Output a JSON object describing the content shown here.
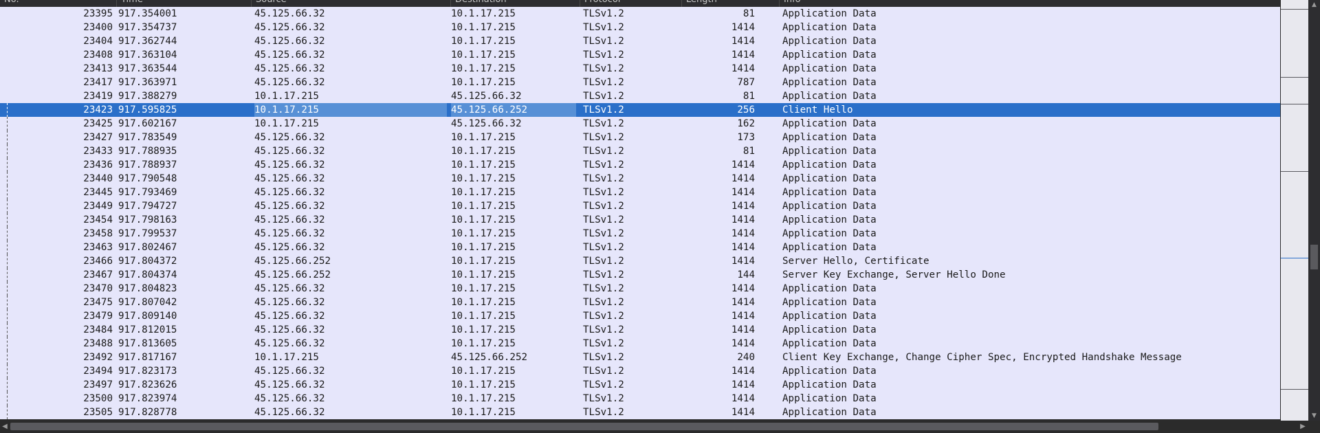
{
  "columns": {
    "no": "No.",
    "time": "Time",
    "source": "Source",
    "destination": "Destination",
    "protocol": "Protocol",
    "length": "Length",
    "info": "Info"
  },
  "colors": {
    "row_bg": "#e6e6fb",
    "selected_bg": "#2a6fc9",
    "header_bg": "#2d2d30"
  },
  "selected_packet": "23423",
  "packets": [
    {
      "no": "23395",
      "time": "917.354001",
      "source": "45.125.66.32",
      "destination": "10.1.17.215",
      "protocol": "TLSv1.2",
      "length": "81",
      "info": "Application Data"
    },
    {
      "no": "23400",
      "time": "917.354737",
      "source": "45.125.66.32",
      "destination": "10.1.17.215",
      "protocol": "TLSv1.2",
      "length": "1414",
      "info": "Application Data"
    },
    {
      "no": "23404",
      "time": "917.362744",
      "source": "45.125.66.32",
      "destination": "10.1.17.215",
      "protocol": "TLSv1.2",
      "length": "1414",
      "info": "Application Data"
    },
    {
      "no": "23408",
      "time": "917.363104",
      "source": "45.125.66.32",
      "destination": "10.1.17.215",
      "protocol": "TLSv1.2",
      "length": "1414",
      "info": "Application Data"
    },
    {
      "no": "23413",
      "time": "917.363544",
      "source": "45.125.66.32",
      "destination": "10.1.17.215",
      "protocol": "TLSv1.2",
      "length": "1414",
      "info": "Application Data"
    },
    {
      "no": "23417",
      "time": "917.363971",
      "source": "45.125.66.32",
      "destination": "10.1.17.215",
      "protocol": "TLSv1.2",
      "length": "787",
      "info": "Application Data"
    },
    {
      "no": "23419",
      "time": "917.388279",
      "source": "10.1.17.215",
      "destination": "45.125.66.32",
      "protocol": "TLSv1.2",
      "length": "81",
      "info": "Application Data"
    },
    {
      "no": "23423",
      "time": "917.595825",
      "source": "10.1.17.215",
      "destination": "45.125.66.252",
      "protocol": "TLSv1.2",
      "length": "256",
      "info": "Client Hello"
    },
    {
      "no": "23425",
      "time": "917.602167",
      "source": "10.1.17.215",
      "destination": "45.125.66.32",
      "protocol": "TLSv1.2",
      "length": "162",
      "info": "Application Data"
    },
    {
      "no": "23427",
      "time": "917.783549",
      "source": "45.125.66.32",
      "destination": "10.1.17.215",
      "protocol": "TLSv1.2",
      "length": "173",
      "info": "Application Data"
    },
    {
      "no": "23433",
      "time": "917.788935",
      "source": "45.125.66.32",
      "destination": "10.1.17.215",
      "protocol": "TLSv1.2",
      "length": "81",
      "info": "Application Data"
    },
    {
      "no": "23436",
      "time": "917.788937",
      "source": "45.125.66.32",
      "destination": "10.1.17.215",
      "protocol": "TLSv1.2",
      "length": "1414",
      "info": "Application Data"
    },
    {
      "no": "23440",
      "time": "917.790548",
      "source": "45.125.66.32",
      "destination": "10.1.17.215",
      "protocol": "TLSv1.2",
      "length": "1414",
      "info": "Application Data"
    },
    {
      "no": "23445",
      "time": "917.793469",
      "source": "45.125.66.32",
      "destination": "10.1.17.215",
      "protocol": "TLSv1.2",
      "length": "1414",
      "info": "Application Data"
    },
    {
      "no": "23449",
      "time": "917.794727",
      "source": "45.125.66.32",
      "destination": "10.1.17.215",
      "protocol": "TLSv1.2",
      "length": "1414",
      "info": "Application Data"
    },
    {
      "no": "23454",
      "time": "917.798163",
      "source": "45.125.66.32",
      "destination": "10.1.17.215",
      "protocol": "TLSv1.2",
      "length": "1414",
      "info": "Application Data"
    },
    {
      "no": "23458",
      "time": "917.799537",
      "source": "45.125.66.32",
      "destination": "10.1.17.215",
      "protocol": "TLSv1.2",
      "length": "1414",
      "info": "Application Data"
    },
    {
      "no": "23463",
      "time": "917.802467",
      "source": "45.125.66.32",
      "destination": "10.1.17.215",
      "protocol": "TLSv1.2",
      "length": "1414",
      "info": "Application Data"
    },
    {
      "no": "23466",
      "time": "917.804372",
      "source": "45.125.66.252",
      "destination": "10.1.17.215",
      "protocol": "TLSv1.2",
      "length": "1414",
      "info": "Server Hello, Certificate"
    },
    {
      "no": "23467",
      "time": "917.804374",
      "source": "45.125.66.252",
      "destination": "10.1.17.215",
      "protocol": "TLSv1.2",
      "length": "144",
      "info": "Server Key Exchange, Server Hello Done"
    },
    {
      "no": "23470",
      "time": "917.804823",
      "source": "45.125.66.32",
      "destination": "10.1.17.215",
      "protocol": "TLSv1.2",
      "length": "1414",
      "info": "Application Data"
    },
    {
      "no": "23475",
      "time": "917.807042",
      "source": "45.125.66.32",
      "destination": "10.1.17.215",
      "protocol": "TLSv1.2",
      "length": "1414",
      "info": "Application Data"
    },
    {
      "no": "23479",
      "time": "917.809140",
      "source": "45.125.66.32",
      "destination": "10.1.17.215",
      "protocol": "TLSv1.2",
      "length": "1414",
      "info": "Application Data"
    },
    {
      "no": "23484",
      "time": "917.812015",
      "source": "45.125.66.32",
      "destination": "10.1.17.215",
      "protocol": "TLSv1.2",
      "length": "1414",
      "info": "Application Data"
    },
    {
      "no": "23488",
      "time": "917.813605",
      "source": "45.125.66.32",
      "destination": "10.1.17.215",
      "protocol": "TLSv1.2",
      "length": "1414",
      "info": "Application Data"
    },
    {
      "no": "23492",
      "time": "917.817167",
      "source": "10.1.17.215",
      "destination": "45.125.66.252",
      "protocol": "TLSv1.2",
      "length": "240",
      "info": "Client Key Exchange, Change Cipher Spec, Encrypted Handshake Message"
    },
    {
      "no": "23494",
      "time": "917.823173",
      "source": "45.125.66.32",
      "destination": "10.1.17.215",
      "protocol": "TLSv1.2",
      "length": "1414",
      "info": "Application Data"
    },
    {
      "no": "23497",
      "time": "917.823626",
      "source": "45.125.66.32",
      "destination": "10.1.17.215",
      "protocol": "TLSv1.2",
      "length": "1414",
      "info": "Application Data"
    },
    {
      "no": "23500",
      "time": "917.823974",
      "source": "45.125.66.32",
      "destination": "10.1.17.215",
      "protocol": "TLSv1.2",
      "length": "1414",
      "info": "Application Data"
    },
    {
      "no": "23505",
      "time": "917.828778",
      "source": "45.125.66.32",
      "destination": "10.1.17.215",
      "protocol": "TLSv1.2",
      "length": "1414",
      "info": "Application Data"
    }
  ],
  "scroll_icons": {
    "up": "chevron-up-icon",
    "down": "chevron-down-icon",
    "left": "chevron-left-icon",
    "right": "chevron-right-icon"
  }
}
